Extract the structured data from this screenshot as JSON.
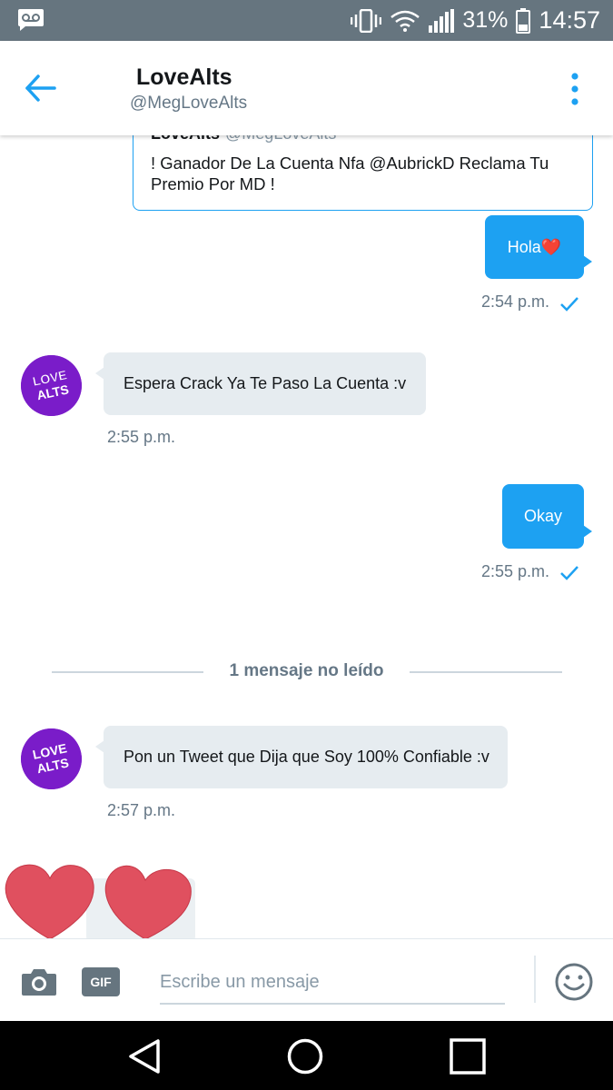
{
  "status_bar": {
    "battery_percent": "31%",
    "time": "14:57",
    "icons": [
      "voicemail-icon",
      "vibrate-icon",
      "wifi-icon",
      "signal-icon",
      "battery-icon"
    ]
  },
  "header": {
    "name": "LoveAlts",
    "handle": "@MegLoveAlts"
  },
  "quoted_tweet": {
    "author": "LoveAlts",
    "handle": "@MegLoveAlts",
    "text": "! Ganador De La Cuenta Nfa @AubrickD Reclama Tu Premio Por MD !"
  },
  "messages": [
    {
      "direction": "out",
      "text": "Hola❤️",
      "time": "2:54 p.m."
    },
    {
      "direction": "in",
      "text": "Espera Crack Ya Te Paso La Cuenta :v",
      "time": "2:55 p.m."
    },
    {
      "direction": "out",
      "text": "Okay",
      "time": "2:55 p.m."
    },
    {
      "direction": "in",
      "text": "Pon un Tweet que Dija que Soy 100% Confiable :v",
      "time": "2:57 p.m."
    }
  ],
  "unread_divider": "1 mensaje no leído",
  "avatar_text": [
    "LOVE",
    "ALTS"
  ],
  "compose": {
    "placeholder": "Escribe un mensaje",
    "gif_label": "GIF"
  },
  "colors": {
    "accent": "#1da1f2",
    "status_bar": "#66757f",
    "incoming_bubble": "#e6ecf0",
    "avatar": "#7a1cc9",
    "heart": "#e0505f"
  }
}
